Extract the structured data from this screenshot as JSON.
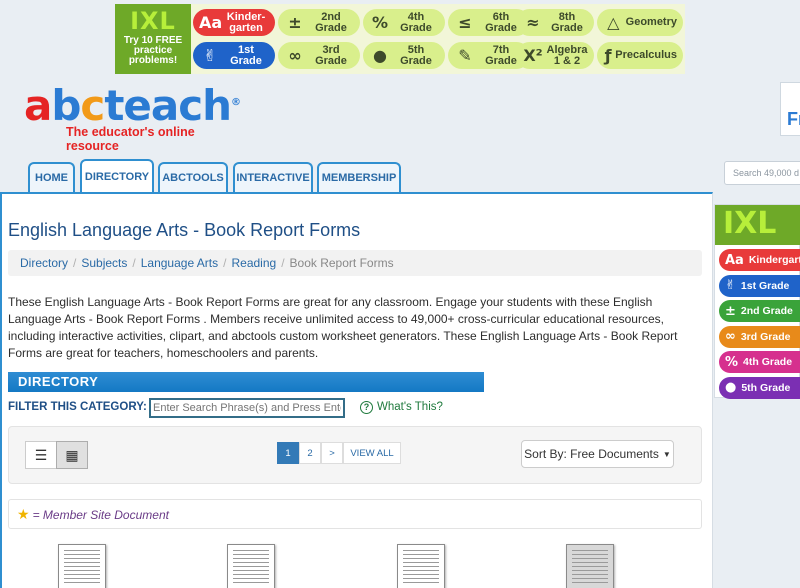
{
  "ixl_banner": {
    "logo": "IXL",
    "promo": [
      "Try 10 FREE",
      "practice",
      "problems!"
    ],
    "pills": [
      {
        "icon": "Aa",
        "label": [
          "Kinder-",
          "garten"
        ],
        "bg": "#e83a3a",
        "fg": "#ffffff"
      },
      {
        "icon": "±",
        "label": [
          "2nd",
          "Grade"
        ],
        "bg": "#d9ef8c",
        "fg": "#3d4a2b"
      },
      {
        "icon": "%",
        "label": [
          "4th",
          "Grade"
        ],
        "bg": "#d9ef8c",
        "fg": "#3d4a2b"
      },
      {
        "icon": "≤",
        "label": [
          "6th",
          "Grade"
        ],
        "bg": "#d9ef8c",
        "fg": "#3d4a2b"
      },
      {
        "icon": "≈",
        "label": [
          "8th",
          "Grade"
        ],
        "bg": "#d9ef8c",
        "fg": "#3d4a2b"
      },
      {
        "icon": "△",
        "label": [
          "Geometry"
        ],
        "bg": "#d9ef8c",
        "fg": "#3d4a2b"
      },
      {
        "icon": "✌",
        "label": [
          "1st",
          "Grade"
        ],
        "bg": "#1f63c9",
        "fg": "#ffffff"
      },
      {
        "icon": "∞",
        "label": [
          "3rd",
          "Grade"
        ],
        "bg": "#d9ef8c",
        "fg": "#3d4a2b"
      },
      {
        "icon": "●",
        "label": [
          "5th",
          "Grade"
        ],
        "bg": "#d9ef8c",
        "fg": "#3d4a2b"
      },
      {
        "icon": "✎",
        "label": [
          "7th",
          "Grade"
        ],
        "bg": "#d9ef8c",
        "fg": "#3d4a2b"
      },
      {
        "icon": "X²",
        "label": [
          "Algebra",
          "1 & 2"
        ],
        "bg": "#d9ef8c",
        "fg": "#3d4a2b"
      },
      {
        "icon": "ƒ",
        "label": [
          "Precalculus"
        ],
        "bg": "#d9ef8c",
        "fg": "#3d4a2b"
      }
    ]
  },
  "brand": {
    "logo_letters": [
      "a",
      "b",
      "c",
      "teach",
      "®"
    ],
    "tagline": "The educator's online resource",
    "right_edge_text": "Fr"
  },
  "nav": {
    "tabs": [
      "HOME",
      "DIRECTORY",
      "ABCTOOLS",
      "INTERACTIVE",
      "MEMBERSHIP"
    ],
    "active": "DIRECTORY"
  },
  "search": {
    "placeholder": "Search 49,000 d"
  },
  "page": {
    "title": "English Language Arts - Book Report Forms",
    "breadcrumb": [
      "Directory",
      "Subjects",
      "Language Arts",
      "Reading"
    ],
    "breadcrumb_current": "Book Report Forms",
    "intro": "These English Language Arts - Book Report Forms are great for any classroom. Engage your students with these English Language Arts - Book Report Forms . Members receive unlimited access to 49,000+ cross-curricular educational resources, including interactive activities, clipart, and abctools custom worksheet generators. These English Language Arts - Book Report Forms are great for teachers, homeschoolers and parents.",
    "directory_heading": "DIRECTORY",
    "filter_label": "FILTER THIS CATEGORY:",
    "filter_placeholder": "Enter Search Phrase(s) and Press Enter",
    "whats_this": "What's This?"
  },
  "toolbar": {
    "pages": [
      "1",
      "2",
      ">",
      "VIEW ALL"
    ],
    "active_page": "1",
    "sort_label": "Sort By: Free Documents"
  },
  "legend": {
    "text": "= Member Site Document"
  },
  "right_ad": {
    "logo": "IXL",
    "pills": [
      {
        "icon": "Aa",
        "label": "Kindergarten",
        "bg": "#e83a3a"
      },
      {
        "icon": "✌",
        "label": "1st Grade",
        "bg": "#1f63c9"
      },
      {
        "icon": "±",
        "label": "2nd Grade",
        "bg": "#3aa33a"
      },
      {
        "icon": "∞",
        "label": "3rd Grade",
        "bg": "#e88a1a"
      },
      {
        "icon": "%",
        "label": "4th Grade",
        "bg": "#d6308e"
      },
      {
        "icon": "●",
        "label": "5th Grade",
        "bg": "#7b2fb3"
      }
    ]
  },
  "colors": {
    "accent": "#2f8fd0",
    "title": "#1f4f86",
    "link": "#2a6aa6"
  }
}
